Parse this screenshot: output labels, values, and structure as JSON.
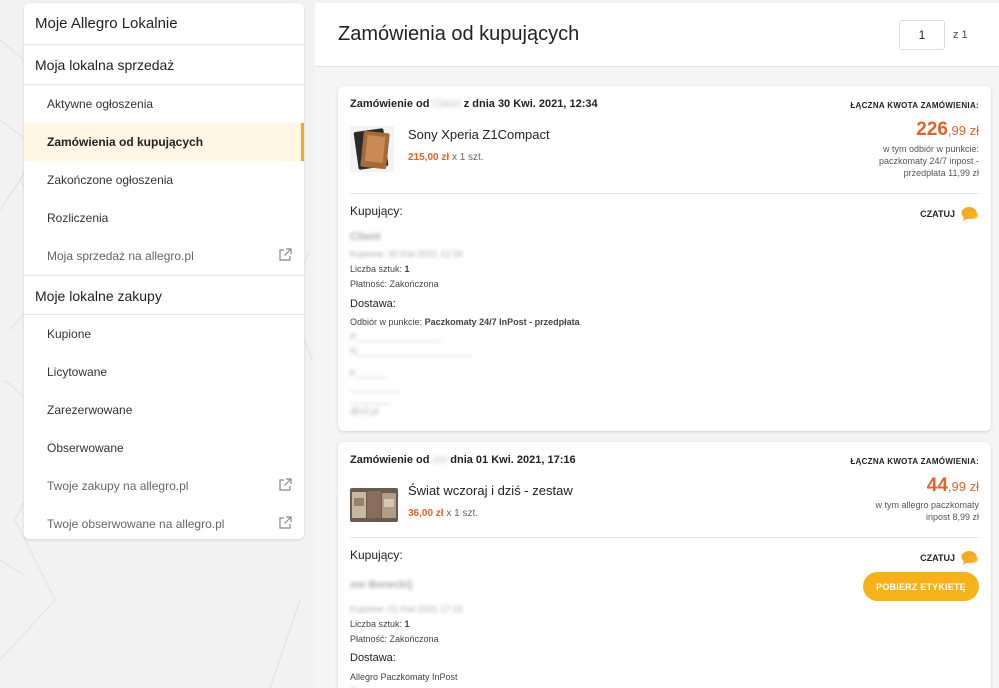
{
  "sidebar": {
    "title": "Moje Allegro Lokalnie",
    "sections": [
      {
        "title": "Moja lokalna sprzedaż",
        "items": [
          {
            "label": "Aktywne ogłoszenia"
          },
          {
            "label": "Zamówienia od kupujących"
          },
          {
            "label": "Zakończone ogłoszenia"
          },
          {
            "label": "Rozliczenia"
          },
          {
            "label": "Moja sprzedaż na allegro.pl"
          }
        ]
      },
      {
        "title": "Moje lokalne zakupy",
        "items": [
          {
            "label": "Kupione"
          },
          {
            "label": "Licytowane"
          },
          {
            "label": "Zarezerwowane"
          },
          {
            "label": "Obserwowane"
          },
          {
            "label": "Twoje zakupy na allegro.pl"
          },
          {
            "label": "Twoje obserwowane na allegro.pl"
          }
        ]
      }
    ]
  },
  "main": {
    "title": "Zamówienia od kupujących",
    "pagination": {
      "current": "1",
      "of_label": "z 1"
    }
  },
  "orders": [
    {
      "title_prefix": "Zamówienie od",
      "buyer_blur": "Client",
      "title_date": "z dnia 30 Kwi. 2021, 12:34",
      "total_label": "ŁĄCZNA KWOTA ZAMÓWIENIA:",
      "total_main": "226",
      "total_cents": ",99 zł",
      "total_note": "w tym odbiór w punkcie: paczkomaty 24/7 inpost - przedpłata 11,99 zł",
      "product_name": "Sony Xperia Z1Compact",
      "product_price": "215,00 zł",
      "product_qty": "x 1 szt.",
      "buyer_label": "Kupujący:",
      "chat_label": "CZATUJ",
      "buyer_name_blur": "Client",
      "bought_label": "Kupione: 30 Kwi 2021 12:34",
      "qty_label": "Liczba sztuk:",
      "qty_value": "1",
      "payment_label": "Płatność:",
      "payment_value": "Zakończona",
      "shipping_label": "Dostawa:",
      "shipping_method_label": "Odbiór w punkcie:",
      "shipping_method_value": "Paczkomaty 24/7 InPost - przedpłata",
      "email_blur": "@o2.pl"
    },
    {
      "title_prefix": "Zamówienie od",
      "buyer_blur": "zm",
      "title_date": "dnia 01 Kwi. 2021, 17:16",
      "total_label": "ŁĄCZNA KWOTA ZAMÓWIENIA:",
      "total_main": "44",
      "total_cents": ",99 zł",
      "total_note": "w tym allegro paczkomaty inpost 8,99 zł",
      "product_name": "Świat wczoraj i dziś - zestaw",
      "product_price": "36,00 zł",
      "product_qty": "x 1 szt.",
      "buyer_label": "Kupujący:",
      "chat_label": "CZATUJ",
      "label_button": "POBIERZ ETYKIETĘ",
      "buyer_name_blur": "zm Borecki)",
      "bought_label": "Kupione: 01 Kwi 2021 17:16",
      "qty_label": "Liczba sztuk:",
      "qty_value": "1",
      "payment_label": "Płatność:",
      "payment_value": "Zakończona",
      "shipping_label": "Dostawa:",
      "shipping_method_value": "Allegro Paczkomaty InPost"
    }
  ],
  "colors": {
    "accent": "#f5a623",
    "price": "#e4612b",
    "button": "#f7b21a"
  }
}
